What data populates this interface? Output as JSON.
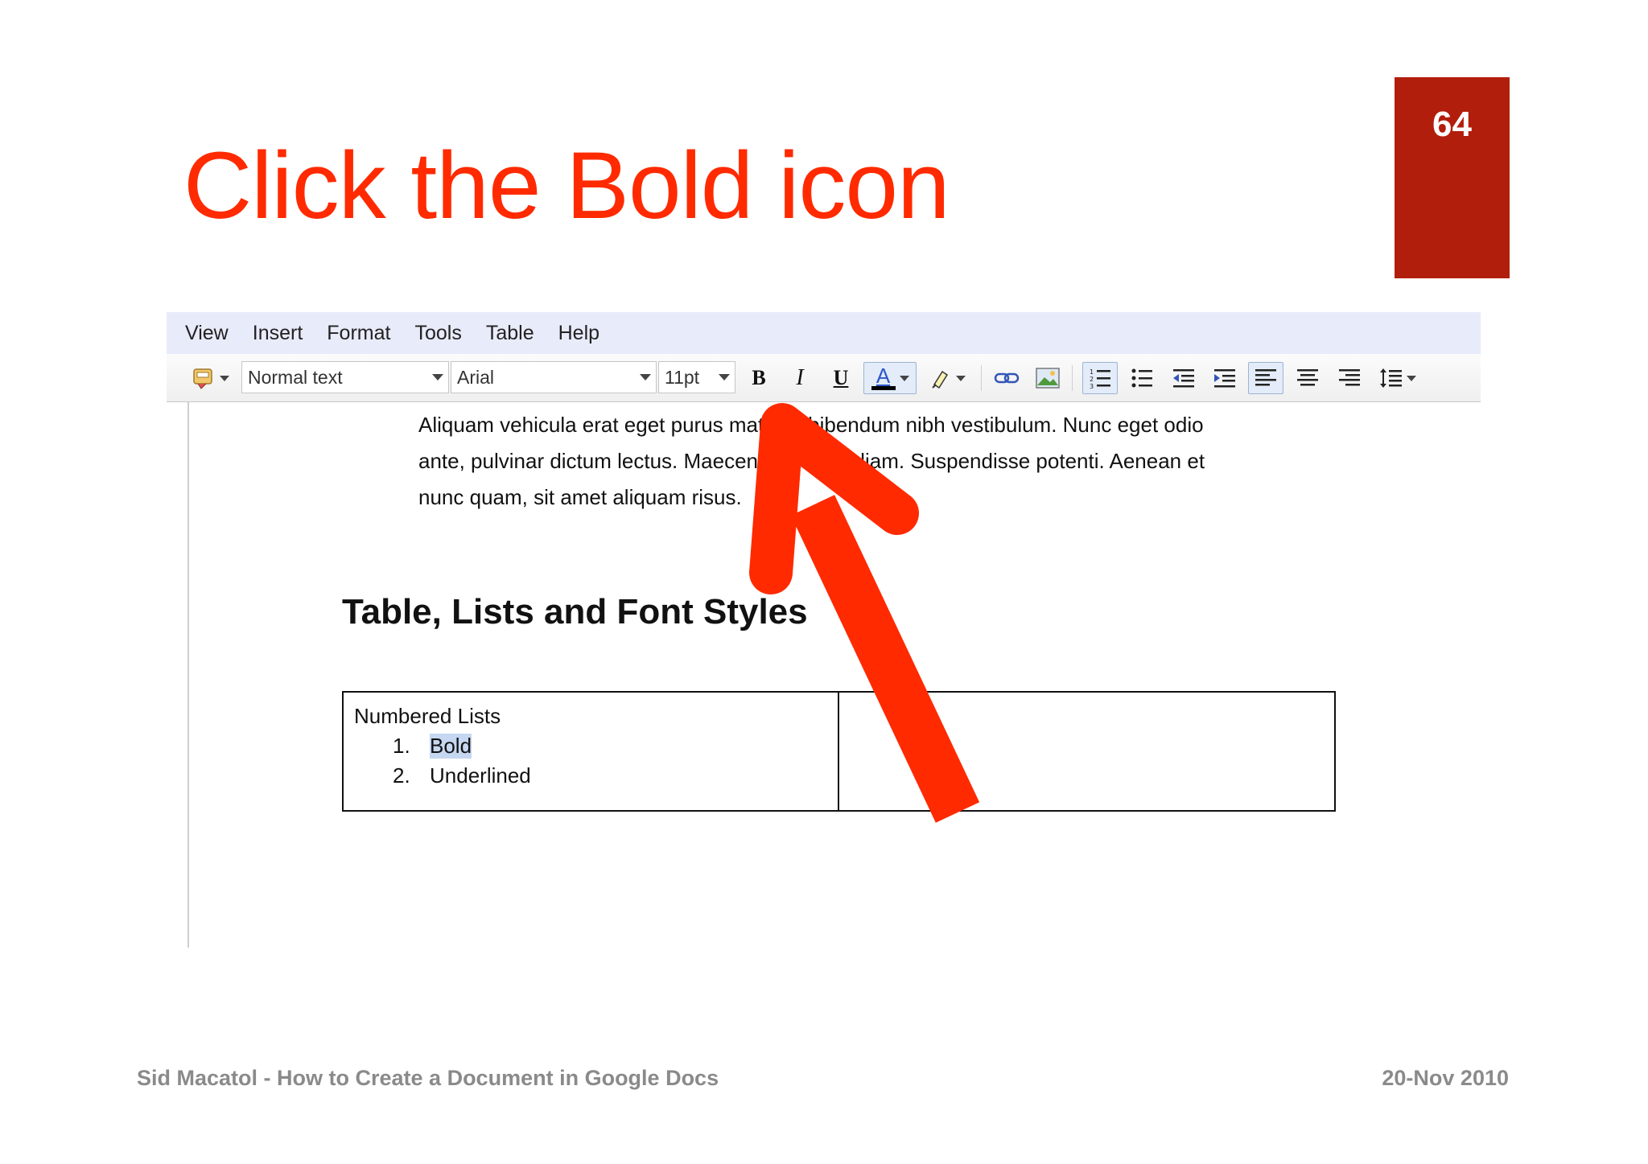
{
  "slide": {
    "title": "Click the Bold icon",
    "page_number": "64",
    "footer_left": "Sid Macatol - How to Create a Document in Google Docs",
    "footer_right": "20-Nov 2010",
    "accent_color": "#ff2a00",
    "badge_color": "#b21e0c"
  },
  "menu": [
    "View",
    "Insert",
    "Format",
    "Tools",
    "Table",
    "Help"
  ],
  "toolbar": {
    "style_select": "Normal text",
    "font_select": "Arial",
    "size_select": "11pt",
    "bold_label": "B",
    "italic_label": "I",
    "underline_label": "U",
    "text_color_label": "A",
    "icons": [
      "paint-format-icon",
      "bold-icon",
      "italic-icon",
      "underline-icon",
      "text-color-icon",
      "highlight-icon",
      "link-icon",
      "image-icon",
      "numbered-list-icon",
      "bulleted-list-icon",
      "decrease-indent-icon",
      "increase-indent-icon",
      "align-left-icon",
      "align-center-icon",
      "align-right-icon",
      "line-spacing-icon"
    ]
  },
  "document": {
    "paragraph_lines": [
      "Aliquam vehicula erat eget purus mattis a bibendum nibh vestibulum. Nunc eget odio",
      "ante, pulvinar dictum lectus. Maecenas blandit diam. Suspendisse potenti. Aenean et",
      "nunc quam, sit amet aliquam risus."
    ],
    "heading": "Table, Lists and Font Styles",
    "table": {
      "cell_title": "Numbered Lists",
      "items": [
        {
          "num": "1.",
          "text": "Bold"
        },
        {
          "num": "2.",
          "text": "Underlined"
        }
      ]
    }
  }
}
